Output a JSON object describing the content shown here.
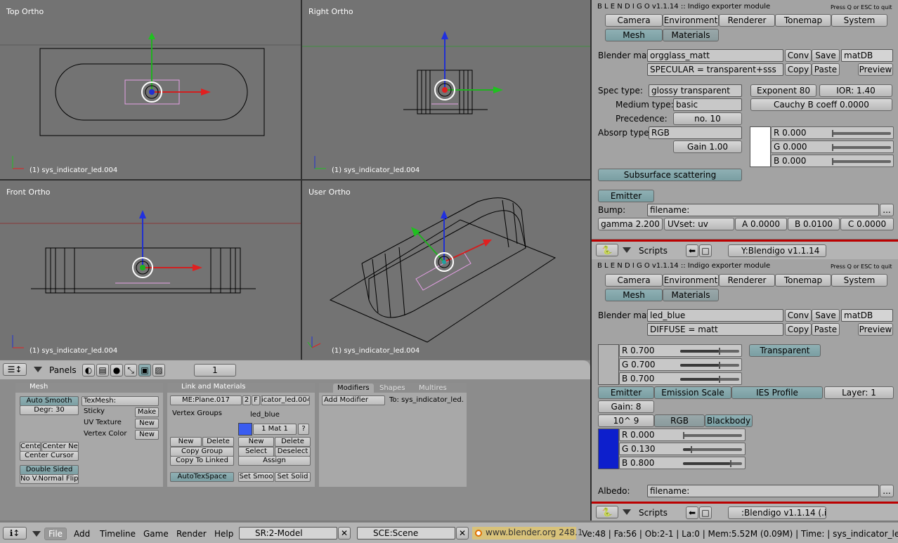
{
  "viewports": {
    "top": {
      "title": "Top Ortho",
      "object": "(1) sys_indicator_led.004"
    },
    "right": {
      "title": "Right Ortho",
      "object": "(1) sys_indicator_led.004"
    },
    "front": {
      "title": "Front Ortho",
      "object": "(1) sys_indicator_led.004"
    },
    "user": {
      "title": "User Ortho",
      "object": "(1) sys_indicator_led.004"
    }
  },
  "buttons_window": {
    "panels_label": "Panels",
    "page_num": "1",
    "mesh": {
      "title": "Mesh",
      "auto_smooth": "Auto Smooth",
      "degr": "Degr: 30",
      "texmesh": "TexMesh:",
      "sticky": "Sticky",
      "make": "Make",
      "uv_texture": "UV Texture",
      "new1": "New",
      "vertex_color": "Vertex Color",
      "new2": "New",
      "cente": "Cente",
      "center_new": "Center Ne",
      "center_cursor": "Center Cursor",
      "double_sided": "Double Sided",
      "no_vnormal_flip": "No V.Normal Flip"
    },
    "link": {
      "title": "Link and Materials",
      "me_name": "ME:Plane.017",
      "users": "2",
      "f": "F",
      "ob_name": "icator_led.004",
      "vertex_groups": "Vertex Groups",
      "mat_name": "led_blue",
      "mat_num": "1 Mat 1",
      "q": "?",
      "new_a": "New",
      "delete_a": "Delete",
      "copy_group": "Copy Group",
      "copy_to_linked": "Copy To Linked",
      "new_b": "New",
      "delete_b": "Delete",
      "select": "Select",
      "deselect": "Deselect",
      "assign": "Assign",
      "autotexspace": "AutoTexSpace",
      "set_smooth": "Set Smoo",
      "set_solid": "Set Solid",
      "mat_color": "#3a5cf0"
    },
    "modifiers": {
      "tab_modifiers": "Modifiers",
      "tab_shapes": "Shapes",
      "tab_multires": "Multires",
      "add_modifier": "Add Modifier",
      "to": "To: sys_indicator_led."
    }
  },
  "blendigo_top": {
    "header": "B L E N D I G O  v1.1.14  ::  Indigo exporter module",
    "quit_hint": "Press Q or ESC to quit",
    "tabs": [
      "Camera",
      "Environment",
      "Renderer",
      "Tonemap",
      "System"
    ],
    "subtabs": [
      "Mesh",
      "Materials"
    ],
    "blender_mat_label": "Blender mat:",
    "blender_mat_value": "orgglass_matt",
    "conv": "Conv",
    "save": "Save",
    "matdb": "matDB",
    "type_value": "SPECULAR = transparent+sss",
    "copy": "Copy",
    "paste": "Paste",
    "preview": "Preview",
    "spec_type_label": "Spec type:",
    "spec_type_value": "glossy transparent",
    "exponent": "Exponent 80",
    "ior": "IOR: 1.40",
    "medium_type_label": "Medium type:",
    "medium_type_value": "basic",
    "cauchy": "Cauchy B coeff 0.0000",
    "precedence_label": "Precedence:",
    "precedence_value": "no. 10",
    "absorp_label": "Absorp type:",
    "absorp_value": "RGB",
    "gain": "Gain 1.00",
    "r": "R 0.000",
    "g": "G 0.000",
    "b": "B 0.000",
    "sss": "Subsurface scattering",
    "emitter": "Emitter",
    "bump_label": "Bump:",
    "bump_value": "filename:",
    "ellipsis": "...",
    "gamma": "gamma 2.200",
    "uvset": "UVset: uv",
    "a": "A 0.0000",
    "bcoef": "B 0.0100",
    "c": "C 0.0000",
    "scripts": "Scripts",
    "script_name": "Y:Blendigo v1.1.14",
    "swatch": "#ffffff"
  },
  "blendigo_bottom": {
    "header": "B L E N D I G O  v1.1.14  ::  Indigo exporter module",
    "quit_hint": "Press Q or ESC to quit",
    "tabs": [
      "Camera",
      "Environment",
      "Renderer",
      "Tonemap",
      "System"
    ],
    "subtabs": [
      "Mesh",
      "Materials"
    ],
    "blender_mat_label": "Blender mat:",
    "blender_mat_value": "led_blue",
    "conv": "Conv",
    "save": "Save",
    "matdb": "matDB",
    "type_value": "DIFFUSE = matt",
    "copy": "Copy",
    "paste": "Paste",
    "preview": "Preview",
    "r": "R 0.700",
    "g": "G 0.700",
    "b": "B 0.700",
    "transparent": "Transparent",
    "emitter": "Emitter",
    "emission_scale": "Emission Scale",
    "ies_profile": "IES Profile",
    "layer": "Layer: 1",
    "gain": "Gain: 8",
    "pow": "10^ 9",
    "rgb": "RGB",
    "blackbody": "Blackbody",
    "er": "R 0.000",
    "eg": "G 0.130",
    "eb": "B 0.800",
    "albedo_label": "Albedo:",
    "albedo_value": "filename:",
    "ellipsis": "...",
    "scripts": "Scripts",
    "script_name": ":Blendigo v1.1.14 (.i",
    "diffuse_swatch": "#b3b3b3",
    "emit_swatch": "#0d1fcc"
  },
  "statusbar": {
    "menus": [
      "File",
      "Add",
      "Timeline",
      "Game",
      "Render",
      "Help"
    ],
    "screen": "SR:2-Model",
    "scene": "SCE:Scene",
    "url": "www.blender.org 248.1",
    "stats": "Ve:48 | Fa:56 | Ob:2-1 | La:0  | Mem:5.52M (0.09M)  | Time: | sys_indicator_led"
  }
}
